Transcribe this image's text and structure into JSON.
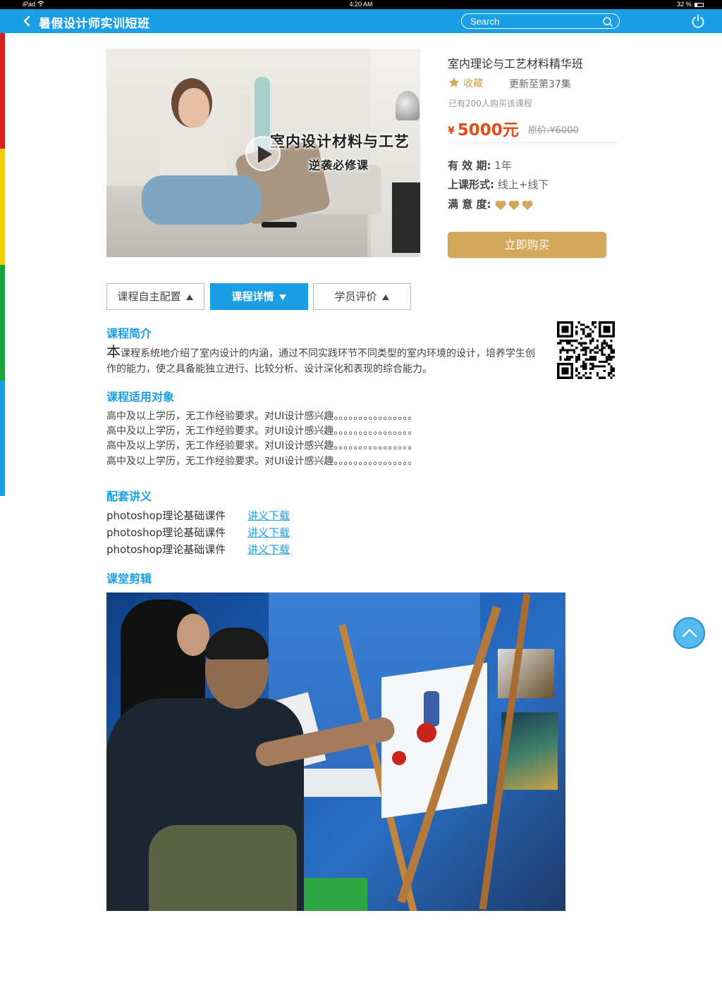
{
  "status_bar": {
    "device": "iPad",
    "time": "4:20 AM",
    "battery": "32 %"
  },
  "nav": {
    "title": "暑假设计师实训短班",
    "search_placeholder": "Search"
  },
  "video": {
    "overlay_title": "室内设计材料与工艺",
    "overlay_subtitle": "逆袭必修课"
  },
  "course": {
    "title": "室内理论与工艺材料精华班",
    "favorite_label": "收藏",
    "updated": "更新至第37集",
    "buyers": "已有200人购买该课程",
    "currency": "¥",
    "price": "5000元",
    "original_price": "原价:¥6000",
    "validity_label": "有 效 期:",
    "validity_value": "1年",
    "format_label": "上课形式:",
    "format_value": "线上+线下",
    "satisfaction_label": "满 意 度:",
    "satisfaction_hearts": 3,
    "buy_label": "立即购买"
  },
  "tabs": [
    {
      "label": "课程自主配置"
    },
    {
      "label": "课程详情"
    },
    {
      "label": "学员评价"
    }
  ],
  "intro": {
    "heading": "课程简介",
    "first_char": "本",
    "text": "课程系统地介绍了室内设计的内涵，通过不同实践环节不同类型的室内环境的设计，培养学生创作的能力，使之具备能独立进行、比较分析、设计深化和表现的综合能力。"
  },
  "audience": {
    "heading": "课程适用对象",
    "lines": [
      "高中及以上学历，无工作经验要求。对UI设计感兴趣。。。。。。。。。。。。。。。。",
      "高中及以上学历，无工作经验要求。对UI设计感兴趣。。。。。。。。。。。。。。。。",
      "高中及以上学历，无工作经验要求。对UI设计感兴趣。。。。。。。。。。。。。。。。",
      "高中及以上学历，无工作经验要求。对UI设计感兴趣。。。。。。。。。。。。。。。。"
    ]
  },
  "handouts": {
    "heading": "配套讲义",
    "items": [
      {
        "name": "photoshop理论基础课件",
        "link": "讲义下载"
      },
      {
        "name": "photoshop理论基础课件",
        "link": "讲义下载"
      },
      {
        "name": "photoshop理论基础课件",
        "link": "讲义下载"
      }
    ]
  },
  "gallery": {
    "heading": "课堂剪辑"
  },
  "colors": {
    "primary": "#1a9ee6",
    "price": "#e24a16",
    "gold": "#d4a85b",
    "stripe": [
      "#d81e1e",
      "#f1d10f",
      "#1aa33a",
      "#1a9ee6"
    ]
  }
}
